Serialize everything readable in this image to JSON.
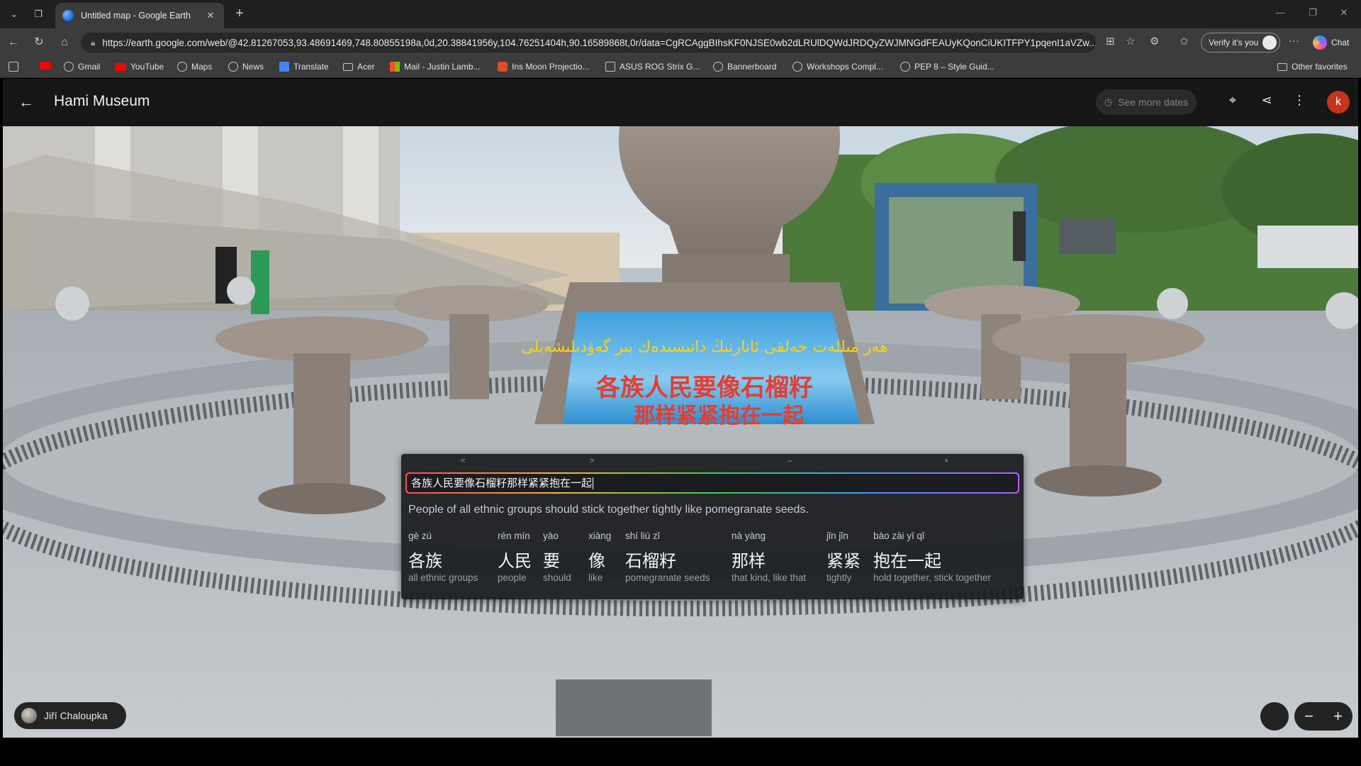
{
  "browser": {
    "tab_title": "Untitled map - Google Earth",
    "url": "https://earth.google.com/web/@42.81267053,93.48691469,748.80855198a,0d,20.38841956y,104.76251404h,90.16589868t,0r/data=CgRCAggBIhsKF0NJSE0wb2dLRUlDQWdJRDQyZWJMNGdFEAUyKQonCiUKITFPY1pqenI1aVZw...",
    "verify_label": "Verify it's you",
    "chat_label": "Chat",
    "bookmarks": [
      "Gmail",
      "YouTube",
      "Maps",
      "News",
      "Translate",
      "Acer",
      "Mail - Justin Lamb...",
      "Ins Moon Projectio...",
      "ASUS ROG Strix G...",
      "Bannerboard",
      "Workshops Compl...",
      "PEP 8 – Style Guid..."
    ],
    "other_favorites": "Other favorites"
  },
  "app": {
    "place_title": "Hami Museum",
    "see_more_dates": "See more dates",
    "account_initial": "k",
    "author": "Jiří Chaloupka"
  },
  "scene": {
    "sign_uyghur": "ھەر مىللەت خەلقى ئانارنىڭ دانىسىدەك بىر گەۋدىلىشەيلى",
    "sign_line1": "各族人民要像石榴籽",
    "sign_line2": "那样紧紧抱在一起"
  },
  "popup": {
    "ctrl_prev": "<",
    "ctrl_next": ">",
    "ctrl_min": "–",
    "ctrl_close": "×",
    "input_text": "各族人民要像石榴籽那样紧紧抱在一起",
    "translation": "People of all ethnic groups should stick together tightly like pomegranate seeds.",
    "words": [
      {
        "pinyin": "gè zú",
        "hanzi": "各族",
        "gloss": "all ethnic groups"
      },
      {
        "pinyin": "rén mín",
        "hanzi": "人民",
        "gloss": "people"
      },
      {
        "pinyin": "yào",
        "hanzi": "要",
        "gloss": "should"
      },
      {
        "pinyin": "xiàng",
        "hanzi": "像",
        "gloss": "like"
      },
      {
        "pinyin": "shí liú zǐ",
        "hanzi": "石榴籽",
        "gloss": "pomegranate seeds"
      },
      {
        "pinyin": "nà yàng",
        "hanzi": "那样",
        "gloss": "that kind, like that"
      },
      {
        "pinyin": "jǐn jǐn",
        "hanzi": "紧紧",
        "gloss": "tightly"
      },
      {
        "pinyin": "bào zài yī qǐ",
        "hanzi": "抱在一起",
        "gloss": "hold together, stick together"
      }
    ]
  },
  "colors": {
    "account_bg": "#c5341b",
    "chrome_dark": "#1f1f1f",
    "toolbar": "#3c3c3c"
  }
}
